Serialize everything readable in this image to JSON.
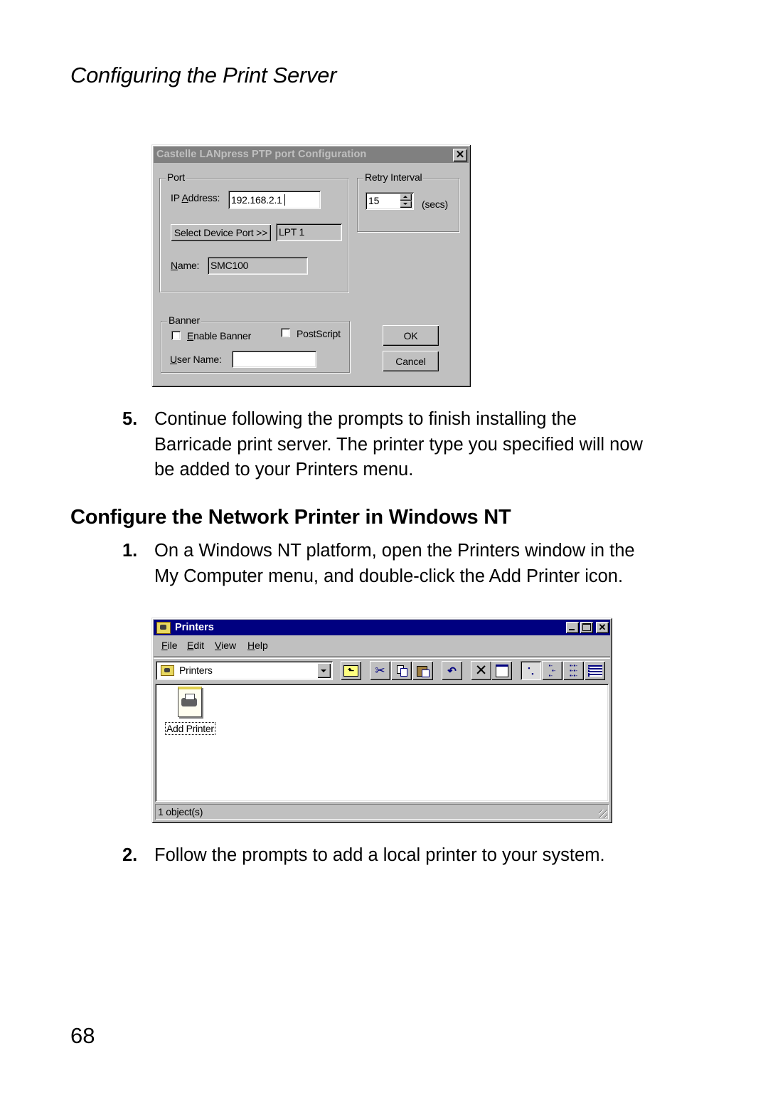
{
  "page": {
    "running_head": "Configuring the Print Server",
    "page_number": "68",
    "section_heading": "Configure the Network Printer in Windows NT",
    "steps": [
      {
        "num": "5.",
        "lines": [
          "Continue following the prompts to finish installing the",
          "Barricade print server. The printer type you specified will now",
          "be added to your Printers menu."
        ]
      },
      {
        "num": "1.",
        "lines": [
          "On a Windows NT platform, open the Printers window in the",
          "My Computer menu, and double-click the Add Printer icon."
        ]
      },
      {
        "num": "2.",
        "lines": [
          "Follow the prompts to add a local printer to your system."
        ]
      }
    ]
  },
  "dialog": {
    "title": "Castelle LANpress PTP port  Configuration",
    "close_icon": "close-icon",
    "port_group": {
      "label": "Port",
      "ip_label": "IP Address:",
      "ip_value": "192.168.2.1",
      "select_port_button": "Select Device Port >>",
      "device_port_value": "LPT 1",
      "name_label": "Name:",
      "name_value": "SMC100"
    },
    "retry_group": {
      "label": "Retry Interval",
      "value": "15",
      "unit": "(secs)"
    },
    "banner_group": {
      "label": "Banner",
      "enable_banner_label": "Enable Banner",
      "enable_banner_checked": false,
      "postscript_label": "PostScript",
      "postscript_checked": false,
      "user_name_label": "User Name:",
      "user_name_value": ""
    },
    "ok_button": "OK",
    "cancel_button": "Cancel"
  },
  "printers_window": {
    "title": "Printers",
    "title_icon": "printers-folder-icon",
    "caption_buttons": [
      "minimize",
      "maximize",
      "close"
    ],
    "menu": [
      "File",
      "Edit",
      "View",
      "Help"
    ],
    "address_value": "Printers",
    "toolbar": [
      "up-one-level",
      "cut",
      "copy",
      "paste",
      "undo",
      "delete",
      "properties",
      "large-icons",
      "small-icons",
      "list",
      "details"
    ],
    "items": [
      {
        "label": "Add Printer",
        "icon": "add-printer-icon",
        "selected": true
      }
    ],
    "status": "1 object(s)",
    "colors": {
      "titlebar": "#000080"
    }
  }
}
